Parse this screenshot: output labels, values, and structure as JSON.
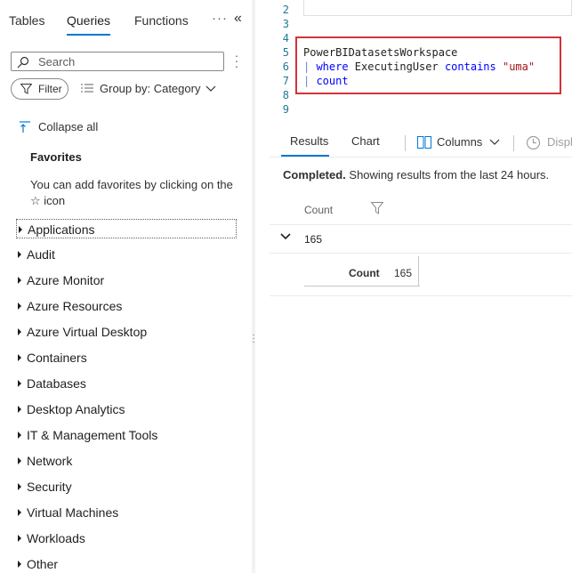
{
  "left_panel": {
    "tabs": [
      "Tables",
      "Queries",
      "Functions"
    ],
    "search_placeholder": "Search",
    "filter_label": "Filter",
    "group_by_label": "Group by: Category",
    "collapse_all_label": "Collapse all",
    "favorites_title": "Favorites",
    "favorites_hint": "You can add favorites by clicking on the ☆ icon",
    "categories": [
      "Applications",
      "Audit",
      "Azure Monitor",
      "Azure Resources",
      "Azure Virtual Desktop",
      "Containers",
      "Databases",
      "Desktop Analytics",
      "IT & Management Tools",
      "Network",
      "Security",
      "Virtual Machines",
      "Workloads",
      "Other"
    ]
  },
  "editor": {
    "line_numbers": [
      "2",
      "3",
      "4",
      "5",
      "6",
      "7",
      "8",
      "9"
    ],
    "line5": "PowerBIDatasetsWorkspace",
    "line6_pipe": "| ",
    "line6_kw1": "where",
    "line6_mid": " ExecutingUser ",
    "line6_kw2": "contains",
    "line6_sp": " ",
    "line6_str": "\"uma\"",
    "line7_pipe": "| ",
    "line7_kw": "count"
  },
  "results": {
    "tabs": [
      "Results",
      "Chart"
    ],
    "columns_label": "Columns",
    "display_label": "Displ",
    "status_bold": "Completed.",
    "status_text": " Showing results from the last 24 hours.",
    "column_header": "Count",
    "row_value": "165",
    "detail_key": "Count",
    "detail_value": "165"
  },
  "colors": {
    "accent": "#0078d4",
    "highlight_border": "#d13438",
    "keyword": "#0000ff",
    "string": "#a31515"
  }
}
